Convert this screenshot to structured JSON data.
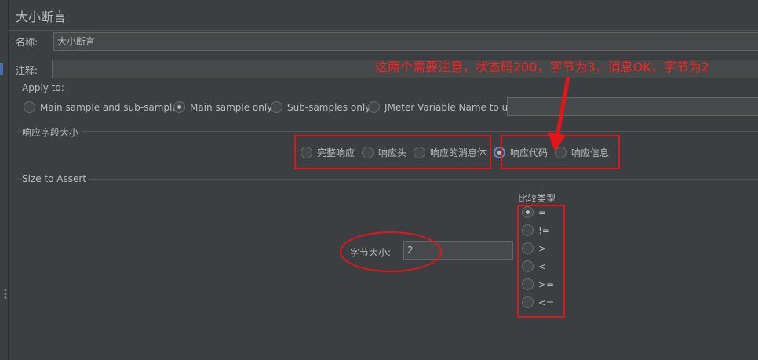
{
  "panel": {
    "title": "大小断言",
    "name_label": "名称:",
    "name_value": "大小断言",
    "comment_label": "注释:",
    "comment_value": ""
  },
  "apply_to": {
    "title": "Apply to:",
    "options": [
      {
        "label": "Main sample and sub-samples",
        "selected": false
      },
      {
        "label": "Main sample only",
        "selected": true
      },
      {
        "label": "Sub-samples only",
        "selected": false
      },
      {
        "label": "JMeter Variable Name to use",
        "selected": false
      }
    ],
    "variable_value": ""
  },
  "response_field": {
    "title": "响应字段大小",
    "options": [
      {
        "label": "完整响应",
        "selected": false
      },
      {
        "label": "响应头",
        "selected": false
      },
      {
        "label": "响应的消息体",
        "selected": false
      },
      {
        "label": "响应代码",
        "selected": true
      },
      {
        "label": "响应信息",
        "selected": false
      }
    ]
  },
  "size_to_assert": {
    "title": "Size to Assert",
    "size_label": "字节大小:",
    "size_value": "2",
    "compare_title": "比较类型",
    "compare_options": [
      {
        "label": "=",
        "selected": true
      },
      {
        "label": "!=",
        "selected": false
      },
      {
        "label": ">",
        "selected": false
      },
      {
        "label": "<",
        "selected": false
      },
      {
        "label": ">=",
        "selected": false
      },
      {
        "label": "<=",
        "selected": false
      }
    ]
  },
  "annotation": {
    "text": "这两个需要注意，状态码200，字节为3，消息OK，字节为2",
    "color": "#ff2020"
  },
  "colors": {
    "background": "#3c3f41",
    "input_bg": "#45494a",
    "text": "#bbbbbb",
    "highlight": "#e0161b",
    "focus": "#5a8fd6"
  }
}
